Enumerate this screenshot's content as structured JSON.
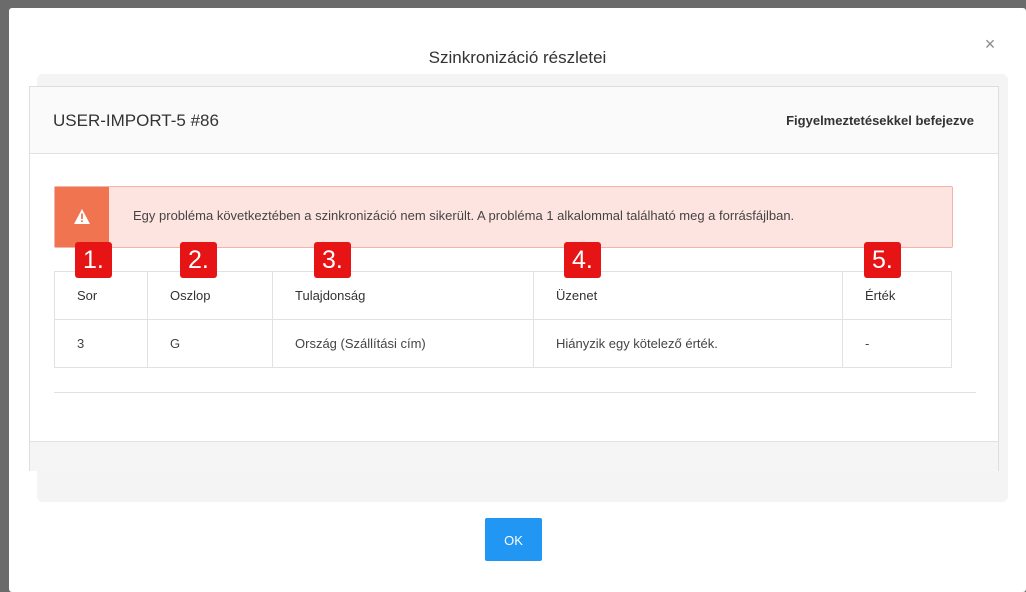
{
  "dialog": {
    "title": "Szinkronizáció részletei",
    "close_glyph": "×"
  },
  "job": {
    "id": "USER-IMPORT-5 #86",
    "status": "Figyelmeztetésekkel befejezve"
  },
  "alert": {
    "icon": "warning-icon",
    "message": "Egy probléma következtében a szinkronizáció nem sikerült. A probléma 1 alkalommal található meg a forrásfájlban.",
    "color": "#f0744f",
    "background": "#fde4e0"
  },
  "table": {
    "columns": [
      "Sor",
      "Oszlop",
      "Tulajdonság",
      "Üzenet",
      "Érték"
    ],
    "rows": [
      [
        "3",
        "G",
        "Ország (Szállítási cím)",
        "Hiányzik egy kötelező érték.",
        "-"
      ]
    ]
  },
  "annotations": [
    "1.",
    "2.",
    "3.",
    "4.",
    "5."
  ],
  "annotation_color": "#e61414",
  "buttons": {
    "ok_label": "OK",
    "ok_color": "#2196f3"
  }
}
